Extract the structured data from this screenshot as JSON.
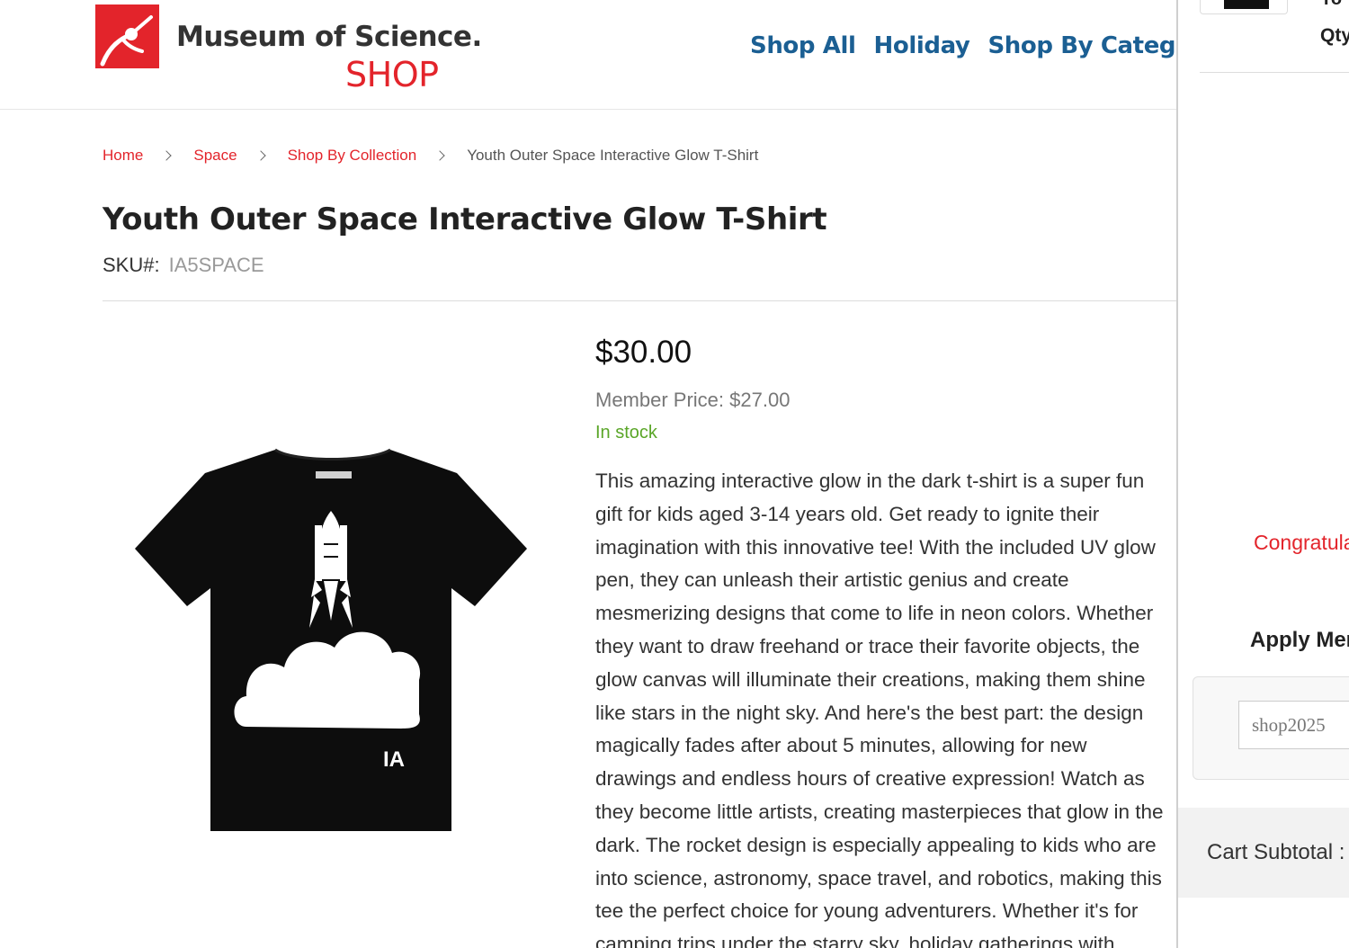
{
  "brand": {
    "name": "Museum of Science.",
    "shop": "SHOP",
    "accent_color": "#e3242b",
    "nav_color": "#1b5f93"
  },
  "nav": {
    "items": [
      {
        "label": "Shop All"
      },
      {
        "label": "Holiday"
      },
      {
        "label": "Shop By Category"
      }
    ]
  },
  "breadcrumb": {
    "items": [
      "Home",
      "Space",
      "Shop By Collection"
    ],
    "current": "Youth Outer Space Interactive Glow T-Shirt"
  },
  "product": {
    "title": "Youth Outer Space Interactive Glow T-Shirt",
    "sku_label": "SKU#:",
    "sku": "IA5SPACE",
    "price": "$30.00",
    "member_price": "Member Price: $27.00",
    "stock": "In stock",
    "stock_color": "#5aa628",
    "image_logo_text": "IA",
    "image_icon": "tshirt-rocket-image",
    "description": "This amazing interactive glow in the dark t-shirt is a super fun gift for kids aged 3-14 years old. Get ready to ignite their imagination with this innovative tee! With the included UV glow pen, they can unleash their artistic genius and create mesmerizing designs that come to life in neon colors. Whether they want to draw freehand or trace their favorite objects, the glow canvas will illuminate their creations, making them shine like stars in the night sky. And here's the best part: the design magically fades after about 5 minutes, allowing for new drawings and endless hours of creative expression! Watch as they become little artists, creating masterpieces that glow in the dark. The rocket design is especially appealing to kids who are into science, astronomy, space travel, and robotics, making this tee the perfect choice for young adventurers. Whether it's for camping trips under the starry sky, holiday gatherings with family"
  },
  "cart": {
    "header_fragment": "Yo",
    "qty_label": "Qty",
    "congrats_text": "Congratula",
    "apply_title": "Apply Mer",
    "promo_value": "shop2025",
    "subtotal_label": "Cart Subtotal :"
  }
}
